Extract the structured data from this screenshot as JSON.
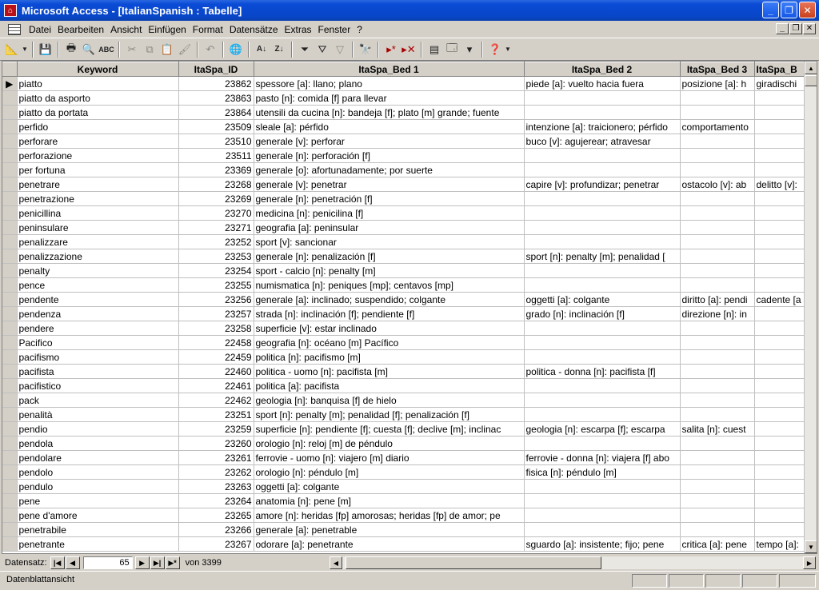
{
  "window": {
    "title": "Microsoft Access - [ItalianSpanish : Tabelle]"
  },
  "menu": [
    "Datei",
    "Bearbeiten",
    "Ansicht",
    "Einfügen",
    "Format",
    "Datensätze",
    "Extras",
    "Fenster",
    "?"
  ],
  "toolbar": {
    "icons": [
      "view-design-icon",
      "save-icon",
      "print-icon",
      "print-preview-icon",
      "spellcheck-icon",
      "cut-icon",
      "copy-icon",
      "paste-icon",
      "format-painter-icon",
      "undo-icon",
      "insert-hyperlink-icon",
      "sort-ascending-icon",
      "sort-descending-icon",
      "filter-by-selection-icon",
      "filter-by-form-icon",
      "apply-filter-icon",
      "find-icon",
      "new-record-icon",
      "delete-record-icon",
      "properties-icon",
      "database-window-icon",
      "new-object-icon",
      "help-icon"
    ]
  },
  "grid": {
    "columns": [
      "Keyword",
      "ItaSpa_ID",
      "ItaSpa_Bed 1",
      "ItaSpa_Bed 2",
      "ItaSpa_Bed 3",
      "ItaSpa_B"
    ],
    "rows": [
      [
        "piatto",
        "23862",
        "spessore [a]: llano; plano",
        "piede [a]: vuelto hacia fuera",
        "posizione [a]: h",
        "giradischi"
      ],
      [
        "piatto da asporto",
        "23863",
        "pasto [n]: comida [f] para llevar",
        "",
        "",
        ""
      ],
      [
        "piatto da portata",
        "23864",
        "utensili da cucina [n]: bandeja [f]; plato [m] grande; fuente",
        "",
        "",
        ""
      ],
      [
        "perfido",
        "23509",
        "sleale [a]: pérfido",
        "intenzione [a]: traicionero; pérfido",
        "comportamento",
        ""
      ],
      [
        "perforare",
        "23510",
        "generale [v]: perforar",
        "buco [v]: agujerear; atravesar",
        "",
        ""
      ],
      [
        "perforazione",
        "23511",
        "generale [n]: perforación [f]",
        "",
        "",
        ""
      ],
      [
        "per fortuna",
        "23369",
        "generale [o]: afortunadamente; por suerte",
        "",
        "",
        ""
      ],
      [
        "penetrare",
        "23268",
        "generale [v]: penetrar",
        "capire [v]: profundizar; penetrar",
        "ostacolo [v]: ab",
        "delitto [v]:"
      ],
      [
        "penetrazione",
        "23269",
        "generale [n]: penetración [f]",
        "",
        "",
        ""
      ],
      [
        "penicillina",
        "23270",
        "medicina [n]: penicilina [f]",
        "",
        "",
        ""
      ],
      [
        "peninsulare",
        "23271",
        "geografia [a]: peninsular",
        "",
        "",
        ""
      ],
      [
        "penalizzare",
        "23252",
        "sport [v]: sancionar",
        "",
        "",
        ""
      ],
      [
        "penalizzazione",
        "23253",
        "generale [n]: penalización [f]",
        "sport [n]: penalty [m]; penalidad [",
        "",
        ""
      ],
      [
        "penalty",
        "23254",
        "sport - calcio [n]: penalty [m]",
        "",
        "",
        ""
      ],
      [
        "pence",
        "23255",
        "numismatica [n]: peniques [mp]; centavos [mp]",
        "",
        "",
        ""
      ],
      [
        "pendente",
        "23256",
        "generale [a]: inclinado; suspendido; colgante",
        "oggetti [a]: colgante",
        "diritto [a]: pendi",
        "cadente [a"
      ],
      [
        "pendenza",
        "23257",
        "strada [n]: inclinación [f]; pendiente [f]",
        "grado [n]: inclinación [f]",
        "direzione [n]: in",
        ""
      ],
      [
        "pendere",
        "23258",
        "superficie [v]: estar inclinado",
        "",
        "",
        ""
      ],
      [
        "Pacifico",
        "22458",
        "geografia [n]: océano [m] Pacífico",
        "",
        "",
        ""
      ],
      [
        "pacifismo",
        "22459",
        "politica [n]: pacifismo [m]",
        "",
        "",
        ""
      ],
      [
        "pacifista",
        "22460",
        "politica - uomo [n]: pacifista [m]",
        "politica - donna [n]: pacifista [f]",
        "",
        ""
      ],
      [
        "pacifistico",
        "22461",
        "politica [a]: pacifista",
        "",
        "",
        ""
      ],
      [
        "pack",
        "22462",
        "geologia [n]: banquisa [f] de hielo",
        "",
        "",
        ""
      ],
      [
        "penalità",
        "23251",
        "sport [n]: penalty [m]; penalidad [f]; penalización [f]",
        "",
        "",
        ""
      ],
      [
        "pendio",
        "23259",
        "superficie [n]: pendiente [f]; cuesta [f]; declive [m]; inclinac",
        "geologia [n]: escarpa [f]; escarpa",
        "salita [n]: cuest",
        ""
      ],
      [
        "pendola",
        "23260",
        "orologio [n]: reloj [m] de péndulo",
        "",
        "",
        ""
      ],
      [
        "pendolare",
        "23261",
        "ferrovie - uomo [n]: viajero [m] diario",
        "ferrovie - donna [n]: viajera [f] abo",
        "",
        ""
      ],
      [
        "pendolo",
        "23262",
        "orologio [n]: péndulo [m]",
        "fisica [n]: péndulo [m]",
        "",
        ""
      ],
      [
        "pendulo",
        "23263",
        "oggetti [a]: colgante",
        "",
        "",
        ""
      ],
      [
        "pene",
        "23264",
        "anatomia [n]: pene [m]",
        "",
        "",
        ""
      ],
      [
        "pene d'amore",
        "23265",
        "amore [n]: heridas [fp] amorosas; heridas [fp] de amor; pe",
        "",
        "",
        ""
      ],
      [
        "penetrabile",
        "23266",
        "generale [a]: penetrable",
        "",
        "",
        ""
      ],
      [
        "penetrante",
        "23267",
        "odorare [a]: penetrante",
        "sguardo [a]: insistente; fijo; pene",
        "critica [a]: pene",
        "tempo [a]:"
      ]
    ]
  },
  "navigator": {
    "label": "Datensatz:",
    "current": "65",
    "of_text": "von 3399"
  },
  "status": {
    "text": "Datenblattansicht"
  }
}
